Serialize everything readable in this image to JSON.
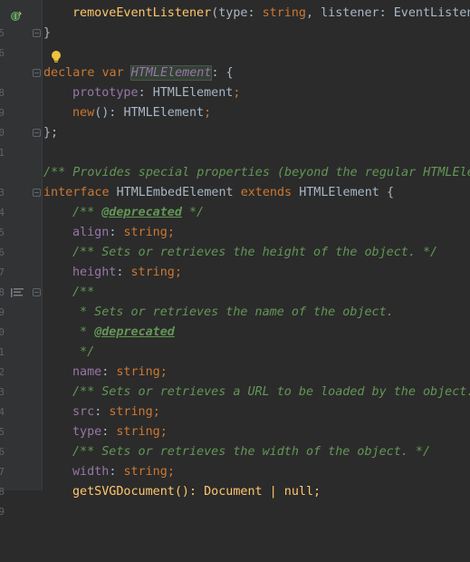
{
  "editor": {
    "line_numbers": [
      "5",
      "6",
      "",
      "8",
      "9",
      "0",
      "1",
      "",
      "3",
      "4",
      "5",
      "6",
      "7",
      "8",
      "9",
      "0",
      "1",
      "2",
      "3",
      "4",
      "5",
      "6",
      "7",
      "8",
      "9"
    ],
    "lines": {
      "l1_fn": "removeEventListener",
      "l1_p1": "type",
      "l1_t1": "string",
      "l1_p2": "listener",
      "l1_t2": "EventListen",
      "l2_brace": "}",
      "l4_kw1": "declare",
      "l4_kw2": "var",
      "l4_name": "HTMLElement",
      "l4_rest": ": {",
      "l5_prop": "prototype",
      "l5_type": "HTMLElement",
      "l6_kw": "new",
      "l6_type": "HTMLElement",
      "l7_brace": "};",
      "l9_comment": "/** Provides special properties (beyond the regular HTMLEle",
      "l10_kw": "interface",
      "l10_name": "HTMLEmbedElement",
      "l10_kw2": "extends",
      "l10_base": "HTMLElement",
      "l10_brace": "{",
      "l11_open": "/** ",
      "l11_tag": "@deprecated",
      "l11_close": " */",
      "l12_prop": "align",
      "l12_type": "string",
      "l13_comment": "/** Sets or retrieves the height of the object. */",
      "l14_prop": "height",
      "l14_type": "string",
      "l15_comment": "/**",
      "l16_comment": " * Sets or retrieves the name of the object.",
      "l17_star": " * ",
      "l17_tag": "@deprecated",
      "l18_comment": " */",
      "l19_prop": "name",
      "l19_type": "string",
      "l20_comment": "/** Sets or retrieves a URL to be loaded by the object.",
      "l21_prop": "src",
      "l21_type": "string",
      "l22_prop": "type",
      "l22_type": "string",
      "l23_comment": "/** Sets or retrieves the width of the object. */",
      "l24_prop": "width",
      "l24_type": "string",
      "l25_partial": "getSVGDocument(): Document | null;"
    }
  },
  "icons": {
    "bulb": "lightbulb-icon",
    "implements": "implements-icon",
    "doc": "doc-comment-icon"
  },
  "colors": {
    "background": "#2b2b2b",
    "gutter": "#313335",
    "keyword": "#cc7832",
    "property": "#9876aa",
    "comment": "#629755",
    "function": "#ffc66d",
    "text": "#a9b7c6"
  }
}
